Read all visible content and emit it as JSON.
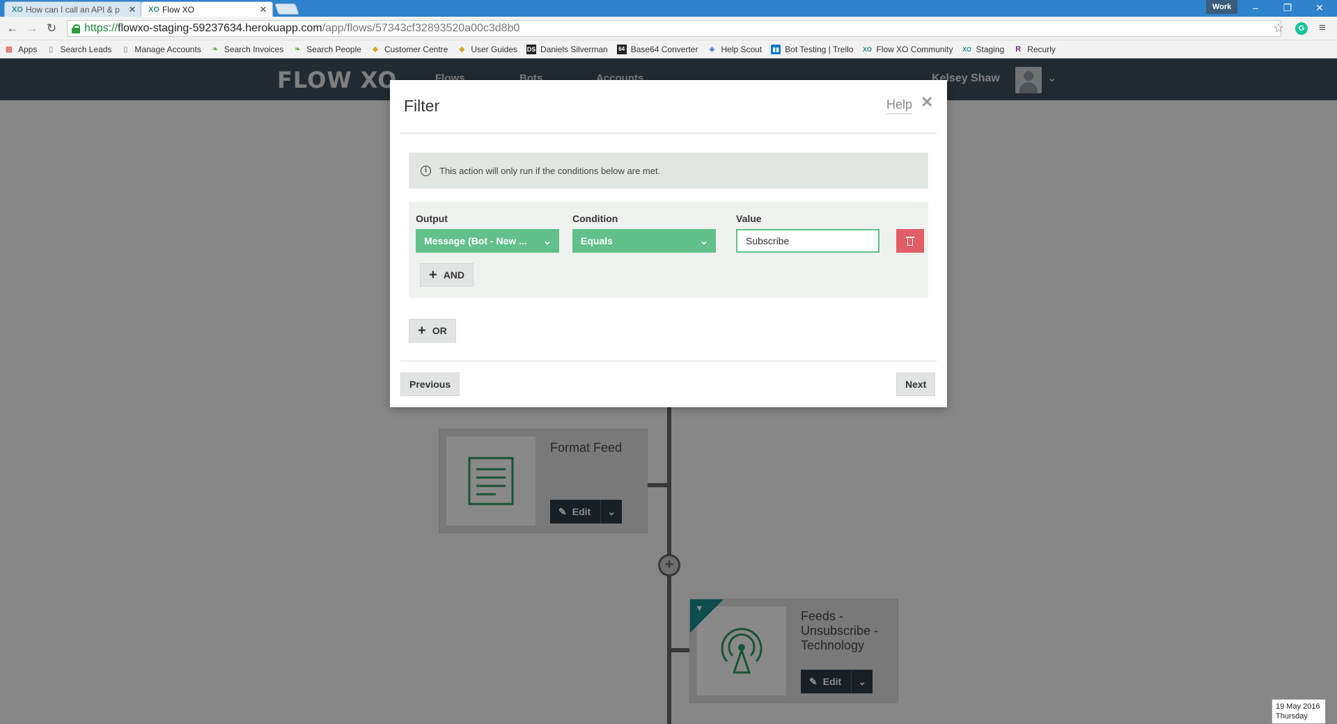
{
  "browser": {
    "tabs": [
      {
        "favicon": "XO",
        "title": "How can I call an API & p",
        "active": false
      },
      {
        "favicon": "XO",
        "title": "Flow XO",
        "active": true
      }
    ],
    "profile": "Work",
    "url": {
      "scheme": "https://",
      "host": "flowxo-staging-59237634.herokuapp.com",
      "path": "/app/flows/57343cf32893520a00c3d8b0"
    },
    "bookmarks": [
      {
        "icon": "apps-grid-icon",
        "label": "Apps"
      },
      {
        "icon": "page-icon",
        "label": "Search Leads"
      },
      {
        "icon": "page-icon",
        "label": "Manage Accounts"
      },
      {
        "icon": "leaf-icon",
        "label": "Search Invoices"
      },
      {
        "icon": "leaf-icon",
        "label": "Search People"
      },
      {
        "icon": "zendesk-icon",
        "label": "Customer Centre"
      },
      {
        "icon": "zendesk-icon",
        "label": "User Guides"
      },
      {
        "icon": "ds-icon",
        "label": "Daniels Silverman"
      },
      {
        "icon": "base64-icon",
        "label": "Base64 Converter"
      },
      {
        "icon": "helpscout-icon",
        "label": "Help Scout"
      },
      {
        "icon": "trello-icon",
        "label": "Bot Testing | Trello"
      },
      {
        "icon": "flowxo-icon",
        "label": "Flow XO Community"
      },
      {
        "icon": "flowxo-icon",
        "label": "Staging"
      },
      {
        "icon": "recurly-icon",
        "label": "Recurly"
      }
    ]
  },
  "app": {
    "logo": "FLOW XO",
    "nav": [
      "Flows",
      "Bots",
      "Accounts"
    ],
    "user": {
      "name": "Kelsey Shaw"
    },
    "steps": [
      {
        "title": "Format Feed",
        "edit_label": "Edit",
        "icon": "document-icon"
      },
      {
        "title": "Feeds - Unsubscribe - Technology",
        "title_lines": [
          "Feeds -",
          "Unsubscribe -",
          "Technology"
        ],
        "edit_label": "Edit",
        "icon": "broadcast-tower-icon",
        "has_filter": true
      }
    ]
  },
  "modal": {
    "title": "Filter",
    "help_label": "Help",
    "info_text": "This action will only run if the conditions below are met.",
    "condition": {
      "output_label": "Output",
      "output_value": "Message (Bot - New ...",
      "condition_label": "Condition",
      "condition_value": "Equals",
      "value_label": "Value",
      "value_value": "Subscribe"
    },
    "and_label": "AND",
    "or_label": "OR",
    "previous_label": "Previous",
    "next_label": "Next"
  },
  "taskbar": {
    "date": "19 May 2016",
    "day": "Thursday"
  },
  "colors": {
    "accent_green": "#62c08b",
    "danger_red": "#e35d67",
    "header_dark": "#3e4f5b",
    "filter_teal": "#1a8b8f"
  }
}
